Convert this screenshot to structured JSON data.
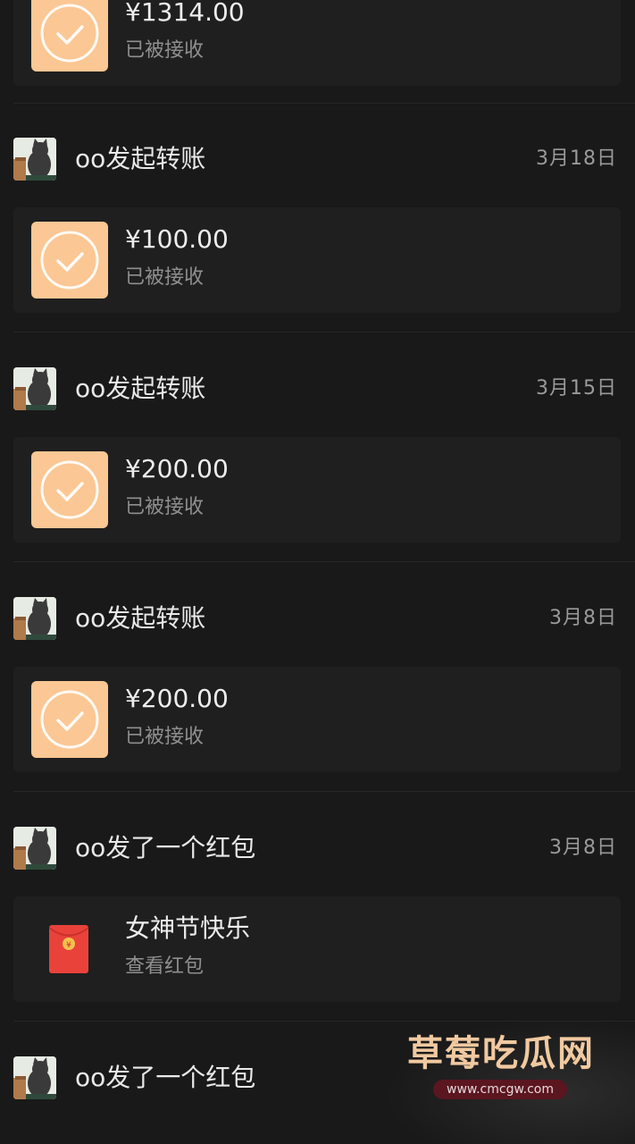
{
  "entries": [
    {
      "type": "transfer",
      "title": "",
      "date": "",
      "amount": "¥1314.00",
      "status": "已被接收"
    },
    {
      "type": "transfer",
      "title": "oo发起转账",
      "date": "3月18日",
      "amount": "¥100.00",
      "status": "已被接收"
    },
    {
      "type": "transfer",
      "title": "oo发起转账",
      "date": "3月15日",
      "amount": "¥200.00",
      "status": "已被接收"
    },
    {
      "type": "transfer",
      "title": "oo发起转账",
      "date": "3月8日",
      "amount": "¥200.00",
      "status": "已被接收"
    },
    {
      "type": "red-packet",
      "title": "oo发了一个红包",
      "date": "3月8日",
      "amount": "女神节快乐",
      "status": "查看红包"
    },
    {
      "type": "red-packet",
      "title": "oo发了一个红包",
      "date": "",
      "amount": "",
      "status": ""
    }
  ],
  "icons": {
    "transfer": "check-circle-icon",
    "red_packet": "red-packet-icon",
    "avatar": "cat-avatar"
  },
  "colors": {
    "background": "#191919",
    "card": "#1f1f1f",
    "transfer_icon": "#fbc794",
    "red_packet": "#e8423b"
  },
  "watermark": {
    "title": "草莓吃瓜网",
    "url": "www.cmcgw.com"
  }
}
